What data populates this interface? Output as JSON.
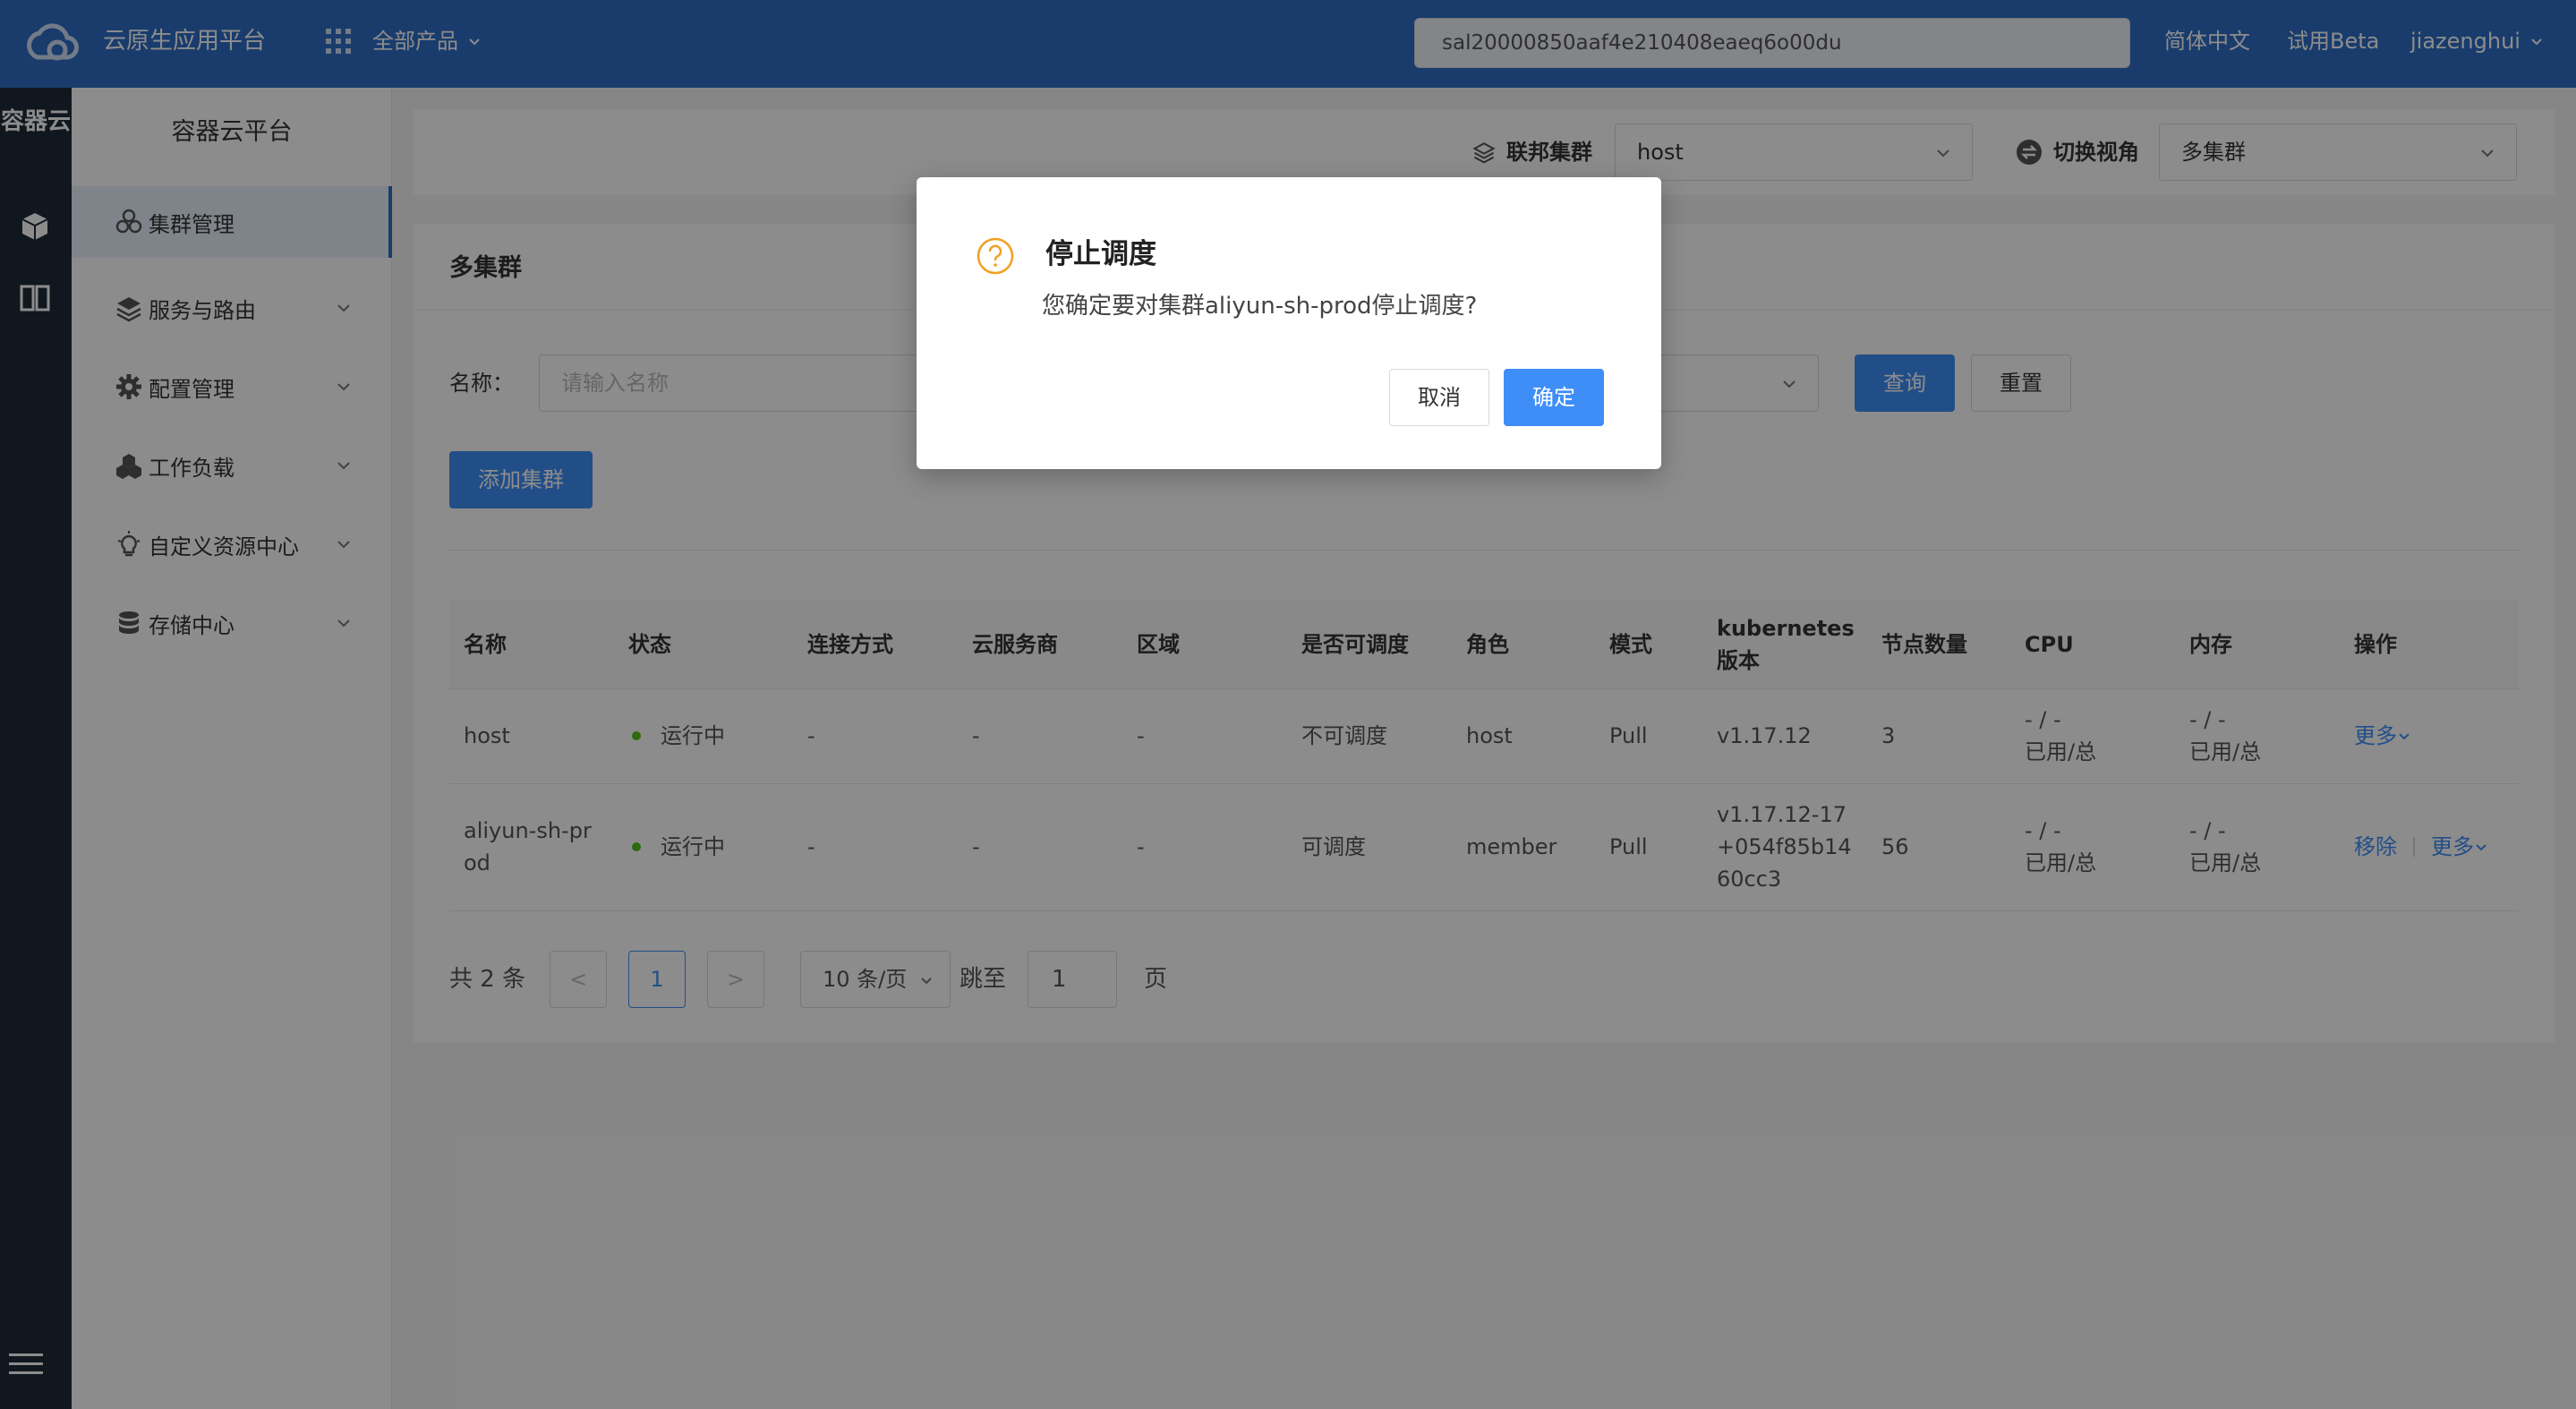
{
  "topbar": {
    "app_title": "云原生应用平台",
    "products_label": "全部产品",
    "search_value": "sal20000850aaf4e210408eaeq6o00du",
    "lang": "简体中文",
    "beta": "试用Beta",
    "user": "jiazenghui"
  },
  "rail": {
    "title": "容器云",
    "icons": [
      "cube-icon",
      "columns-icon",
      "hamburger-menu-icon"
    ]
  },
  "sidemenu": {
    "title": "容器云平台",
    "items": [
      {
        "label": "集群管理",
        "icon": "cluster-icon",
        "active": true
      },
      {
        "label": "服务与路由",
        "icon": "layers-icon"
      },
      {
        "label": "配置管理",
        "icon": "gear-icon"
      },
      {
        "label": "工作负载",
        "icon": "workload-icon"
      },
      {
        "label": "自定义资源中心",
        "icon": "bulb-icon"
      },
      {
        "label": "存储中心",
        "icon": "database-icon"
      }
    ]
  },
  "filterbar": {
    "federation_label": "联邦集群",
    "federation_value": "host",
    "view_label": "切换视角",
    "view_value": "多集群"
  },
  "card": {
    "title": "多集群",
    "name_label": "名称：",
    "name_placeholder": "请输入名称",
    "query_button": "查询",
    "reset_button": "重置",
    "add_button": "添加集群"
  },
  "table": {
    "headers": [
      "名称",
      "状态",
      "连接方式",
      "云服务商",
      "区域",
      "是否可调度",
      "角色",
      "模式",
      "kubernetes版本",
      "节点数量",
      "CPU",
      "内存",
      "操作"
    ],
    "header_k8s_line1": "kubernetes",
    "header_k8s_line2": "版本",
    "rows": [
      {
        "name": "host",
        "status": "运行中",
        "connect": "-",
        "provider": "-",
        "region": "-",
        "schedulable": "不可调度",
        "role": "host",
        "mode": "Pull",
        "version": "v1.17.12",
        "nodes": "3",
        "cpu1": "- / -",
        "cpu2": "已用/总",
        "mem1": "- / -",
        "mem2": "已用/总",
        "more": "更多"
      },
      {
        "name1": "aliyun-sh-pr",
        "name2": "od",
        "status": "运行中",
        "connect": "-",
        "provider": "-",
        "region": "-",
        "schedulable": "可调度",
        "role": "member",
        "mode": "Pull",
        "version1": "v1.17.12-17",
        "version2": "+054f85b14",
        "version3": "60cc3",
        "nodes": "56",
        "cpu1": "- / -",
        "cpu2": "已用/总",
        "mem1": "- / -",
        "mem2": "已用/总",
        "remove": "移除",
        "more": "更多"
      }
    ]
  },
  "pager": {
    "total": "共 2 条",
    "prev": "<",
    "current": "1",
    "next": ">",
    "page_size": "10 条/页",
    "jump_label": "跳至",
    "jump_value": "1",
    "page_suffix": "页"
  },
  "dialog": {
    "title": "停止调度",
    "content": "您确定要对集群aliyun-sh-prod停止调度?",
    "cancel": "取消",
    "ok": "确定",
    "icon": "question-circle-icon"
  },
  "colors": {
    "topbar": "#2f6dc6",
    "primary": "#3f8ef7",
    "rail": "#1f2a3a",
    "status_running": "#52c41a",
    "warning_icon": "#f0a020"
  }
}
